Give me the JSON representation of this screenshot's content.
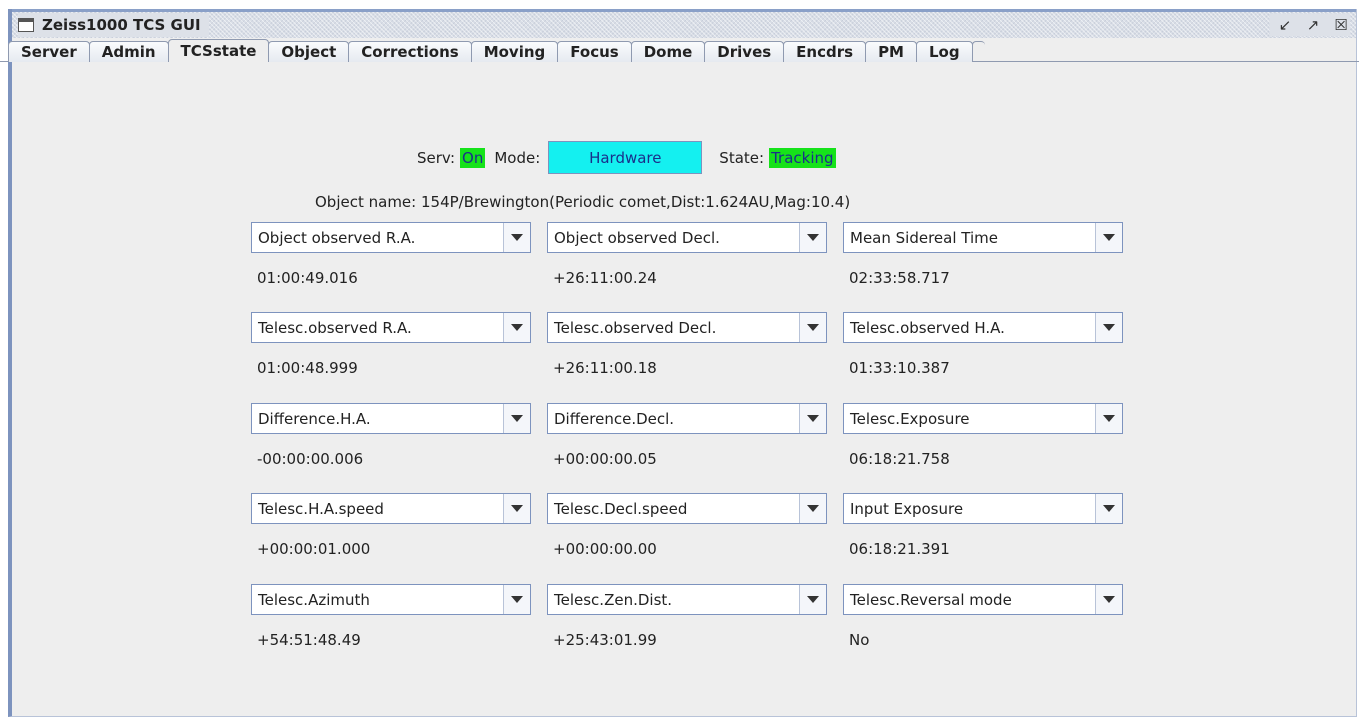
{
  "window": {
    "title": "Zeiss1000 TCS GUI",
    "buttons": [
      "minimize-icon",
      "maximize-icon",
      "close-icon"
    ]
  },
  "tabs": [
    {
      "label": "Server"
    },
    {
      "label": "Admin"
    },
    {
      "label": "TCSstate",
      "active": true
    },
    {
      "label": "Object"
    },
    {
      "label": "Corrections"
    },
    {
      "label": "Moving"
    },
    {
      "label": "Focus"
    },
    {
      "label": "Dome"
    },
    {
      "label": "Drives"
    },
    {
      "label": "Encdrs"
    },
    {
      "label": "PM"
    },
    {
      "label": "Log"
    }
  ],
  "status": {
    "serv_label": "Serv:",
    "serv_value": "On",
    "mode_label": "Mode:",
    "mode_value": "Hardware",
    "state_label": "State:",
    "state_value": "Tracking",
    "highlight_color": "#16e21a",
    "mode_color": "#14f0f0"
  },
  "object_name": "Object name: 154P/Brewington(Periodic comet,Dist:1.624AU,Mag:10.4)",
  "grid": [
    [
      {
        "select": "Object observed R.A.",
        "value": "01:00:49.016"
      },
      {
        "select": "Object observed Decl.",
        "value": "+26:11:00.24"
      },
      {
        "select": "Mean Sidereal Time",
        "value": "02:33:58.717"
      }
    ],
    [
      {
        "select": "Telesc.observed R.A.",
        "value": "01:00:48.999"
      },
      {
        "select": "Telesc.observed Decl.",
        "value": "+26:11:00.18"
      },
      {
        "select": "Telesc.observed H.A.",
        "value": "01:33:10.387"
      }
    ],
    [
      {
        "select": "Difference.H.A.",
        "value": "-00:00:00.006"
      },
      {
        "select": "Difference.Decl.",
        "value": "+00:00:00.05"
      },
      {
        "select": "Telesc.Exposure",
        "value": "06:18:21.758"
      }
    ],
    [
      {
        "select": "Telesc.H.A.speed",
        "value": "+00:00:01.000"
      },
      {
        "select": "Telesc.Decl.speed",
        "value": "+00:00:00.00"
      },
      {
        "select": "Input Exposure",
        "value": "06:18:21.391"
      }
    ],
    [
      {
        "select": "Telesc.Azimuth",
        "value": "+54:51:48.49"
      },
      {
        "select": "Telesc.Zen.Dist.",
        "value": "+25:43:01.99"
      },
      {
        "select": "Telesc.Reversal mode",
        "value": "No"
      }
    ]
  ]
}
